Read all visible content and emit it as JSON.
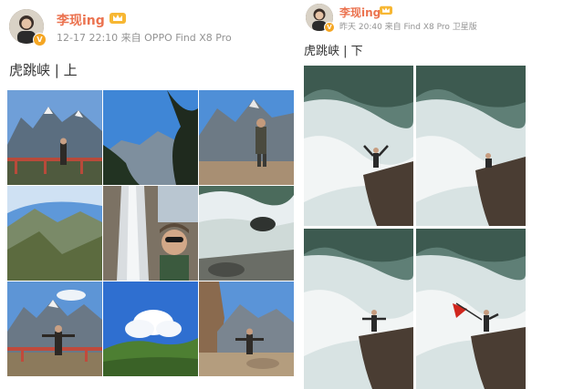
{
  "left_post": {
    "author": "李现ing",
    "meta": "12-17 22:10 来自 OPPO Find X8 Pro",
    "title": "虎跳峡 | 上",
    "avatar_badge": "V",
    "photos": [
      "mountain-railing-person",
      "blue-sky-trees-mountain",
      "hiker-on-rocks",
      "valley-slopes",
      "waterfall-selfie",
      "river-rapids",
      "mountain-railing-pose",
      "green-hill-clouds",
      "rocky-trail-person"
    ]
  },
  "right_post": {
    "author": "李现ing",
    "meta": "昨天 20:40 来自 Find X8 Pro 卫星版",
    "title": "虎跳峡 | 下",
    "avatar_badge": "V",
    "photos": [
      "rapids-rock-arms-up",
      "rapids-rock-sitting",
      "rapids-rock-standing",
      "rapids-rock-flag"
    ]
  },
  "colors": {
    "name": "#eb7350",
    "meta": "#939393",
    "badge": "#f5a623"
  },
  "icons": {
    "crown": "crown-icon",
    "verified": "verified-badge-icon"
  }
}
